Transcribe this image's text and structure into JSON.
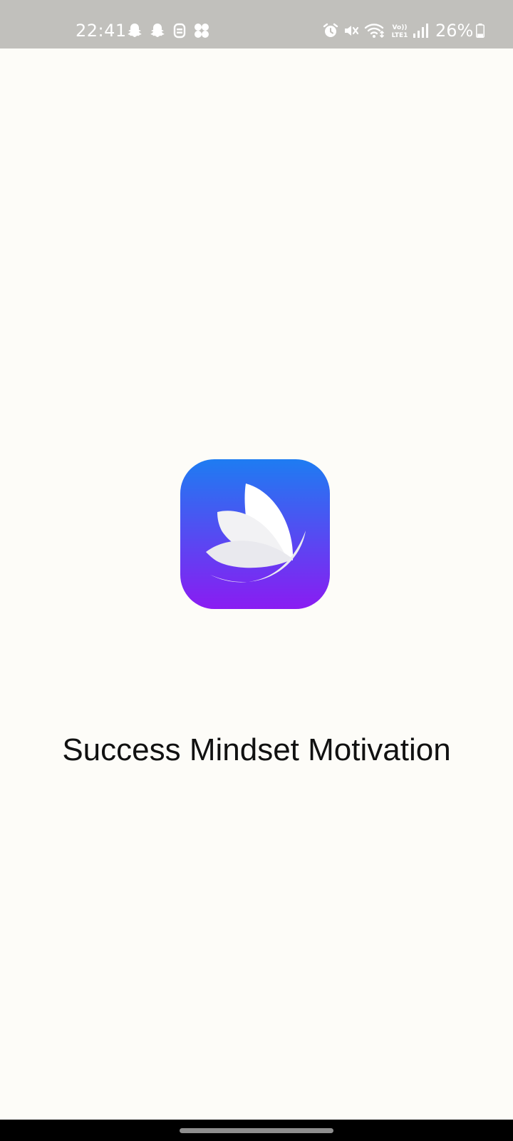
{
  "status_bar": {
    "time": "22:41",
    "left_icons": [
      "snapchat-icon",
      "snapchat-icon",
      "notification-icon",
      "app-grid-icon"
    ],
    "right_icons": [
      "alarm-icon",
      "mute-icon",
      "wifi-icon",
      "volte-lte-icon",
      "signal-icon"
    ],
    "battery_text": "26%",
    "battery_level": 0.26
  },
  "splash": {
    "app_icon": "lotus-leaves-logo",
    "logo_gradient": [
      "#1e7cf2",
      "#8a1cf2"
    ],
    "app_name": "Success Mindset Motivation"
  },
  "nav_bar": {
    "handle_icon": "home-gesture-handle"
  }
}
